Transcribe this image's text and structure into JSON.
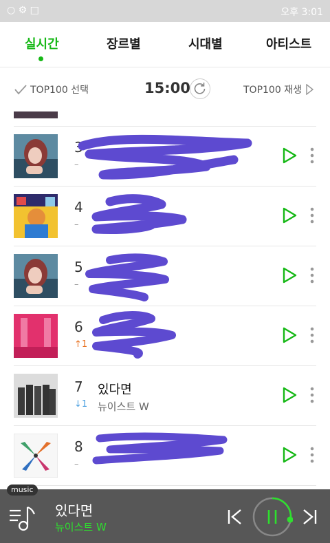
{
  "status_bar": {
    "left_icons": "○ ⚙ □",
    "clock": "오후 3:01"
  },
  "tabs": [
    {
      "label": "실시간",
      "active": true
    },
    {
      "label": "장르별",
      "active": false
    },
    {
      "label": "시대별",
      "active": false
    },
    {
      "label": "아티스트",
      "active": false
    }
  ],
  "controls": {
    "select_label": "TOP100 선택",
    "time": "15:00",
    "play_all_label": "TOP100 재생"
  },
  "rows": [
    {
      "rank": "3",
      "change": "–",
      "title": "",
      "artist": "",
      "redacted": true
    },
    {
      "rank": "4",
      "change": "–",
      "title": "",
      "artist": "",
      "redacted": true
    },
    {
      "rank": "5",
      "change": "–",
      "title": "",
      "artist": "",
      "redacted": true
    },
    {
      "rank": "6",
      "change": "↑1",
      "change_dir": "up",
      "title": "",
      "artist": "",
      "redacted": true
    },
    {
      "rank": "7",
      "change": "↓1",
      "change_dir": "down",
      "title": "있다면",
      "artist": "뉴이스트 W",
      "redacted": false
    },
    {
      "rank": "8",
      "change": "–",
      "title": "",
      "artist": "",
      "redacted": true
    }
  ],
  "player": {
    "tag": "music",
    "now_title": "있다면",
    "now_artist": "뉴이스트 W"
  },
  "colors": {
    "accent": "#16b816",
    "scribble": "#5d4ad0",
    "player_bg": "#575757"
  },
  "icons": [
    "check-icon",
    "refresh-icon",
    "play-icon",
    "more-icon",
    "playlist-icon",
    "prev-icon",
    "pause-icon",
    "next-icon"
  ]
}
